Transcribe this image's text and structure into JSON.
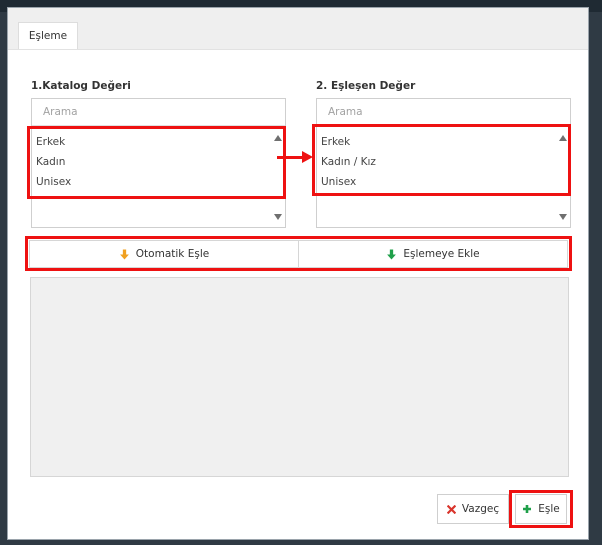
{
  "tab": {
    "label": "Eşleme"
  },
  "left": {
    "title": "1.Katalog Değeri",
    "search_placeholder": "Arama",
    "items": [
      "Erkek",
      "Kadın",
      "Unisex"
    ]
  },
  "right": {
    "title": "2. Eşleşen Değer",
    "search_placeholder": "Arama",
    "items": [
      "Erkek",
      "Kadın / Kız",
      "Unisex"
    ]
  },
  "actions": {
    "auto_match": "Otomatik Eşle",
    "add_to_match": "Eşlemeye Ekle"
  },
  "footer": {
    "cancel": "Vazgeç",
    "match": "Eşle"
  },
  "colors": {
    "highlight": "#ee1111",
    "auto_icon": "#f0a020",
    "add_icon": "#1fa04a",
    "cancel_icon": "#d9342b",
    "match_icon": "#1fa04a"
  }
}
